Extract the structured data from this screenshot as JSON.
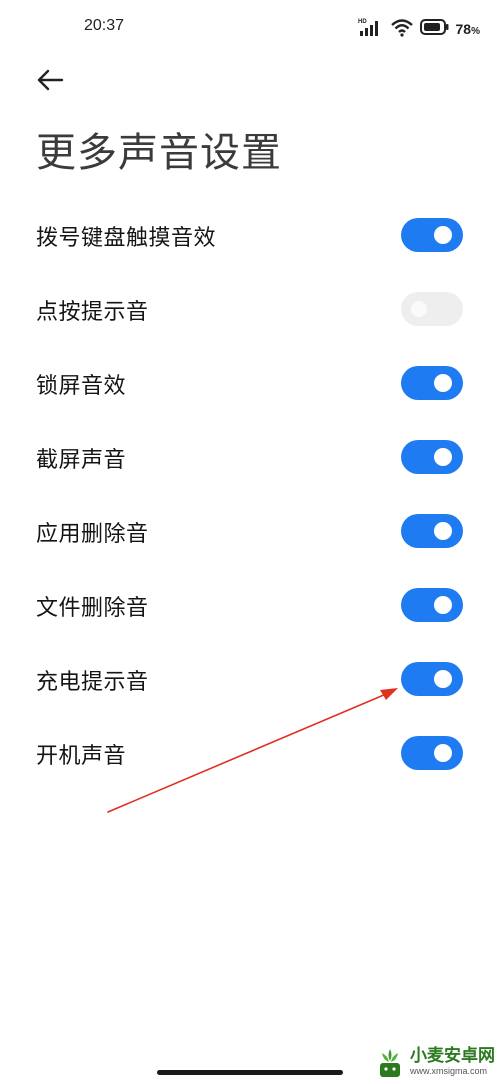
{
  "status_bar": {
    "time": "20:37",
    "battery_percent": "78",
    "battery_suffix": "%",
    "hd_badge": "HD",
    "icons": [
      "signal-icon",
      "wifi-icon",
      "battery-icon"
    ]
  },
  "header": {
    "back_icon": "arrow-left-icon",
    "title": "更多声音设置"
  },
  "settings": [
    {
      "label": "拨号键盘触摸音效",
      "enabled": true
    },
    {
      "label": "点按提示音",
      "enabled": false
    },
    {
      "label": "锁屏音效",
      "enabled": true
    },
    {
      "label": "截屏声音",
      "enabled": true
    },
    {
      "label": "应用删除音",
      "enabled": true
    },
    {
      "label": "文件删除音",
      "enabled": true
    },
    {
      "label": "充电提示音",
      "enabled": true
    },
    {
      "label": "开机声音",
      "enabled": true
    }
  ],
  "annotation": {
    "arrow_color": "#e0301e"
  },
  "colors": {
    "toggle_on": "#1f7bf2",
    "toggle_off": "#eeeeee"
  },
  "watermark": {
    "name": "小麦安卓网",
    "url": "www.xmsigma.com"
  }
}
